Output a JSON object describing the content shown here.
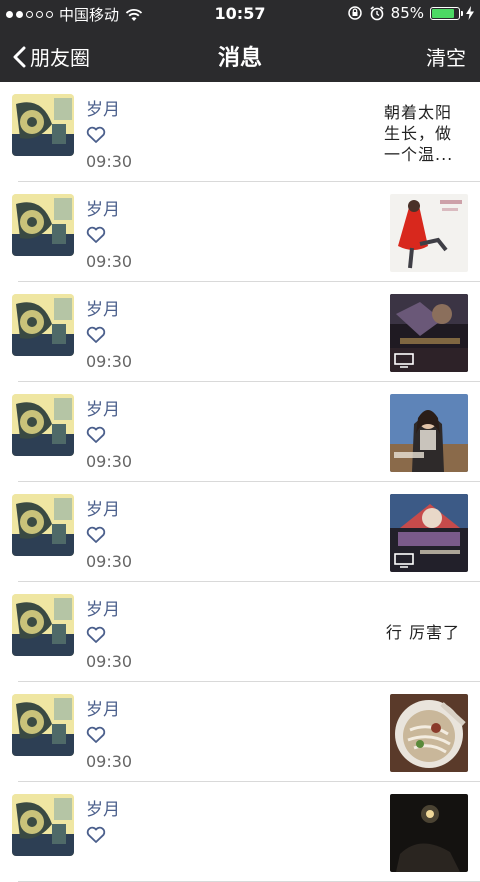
{
  "status_bar": {
    "carrier": "中国移动",
    "time": "10:57",
    "battery": "85%",
    "battery_level": 0.85,
    "signal_dots": [
      true,
      true,
      false,
      false,
      false
    ]
  },
  "nav": {
    "back_label": "朋友圈",
    "title": "消息",
    "clear_label": "清空"
  },
  "messages": [
    {
      "name": "岁月",
      "time": "09:30",
      "content_type": "text",
      "text": "朝着太阳生长，做一个温..."
    },
    {
      "name": "岁月",
      "time": "09:30",
      "content_type": "image",
      "image": "red-dress-photo"
    },
    {
      "name": "岁月",
      "time": "09:30",
      "content_type": "video",
      "image": "video-thumbnail-dark"
    },
    {
      "name": "岁月",
      "time": "09:30",
      "content_type": "image",
      "image": "woman-portrait-photo"
    },
    {
      "name": "岁月",
      "time": "09:30",
      "content_type": "video",
      "image": "video-thumbnail-colorful"
    },
    {
      "name": "岁月",
      "time": "09:30",
      "content_type": "text",
      "text": "行 厉害了"
    },
    {
      "name": "岁月",
      "time": "09:30",
      "content_type": "image",
      "image": "noodle-bowl-photo"
    },
    {
      "name": "岁月",
      "time": "",
      "content_type": "image",
      "image": "dark-night-photo"
    }
  ],
  "colors": {
    "bar_bg": "#2b2b2d",
    "name_color": "#4b5f8c",
    "battery_green": "#4cd964"
  }
}
